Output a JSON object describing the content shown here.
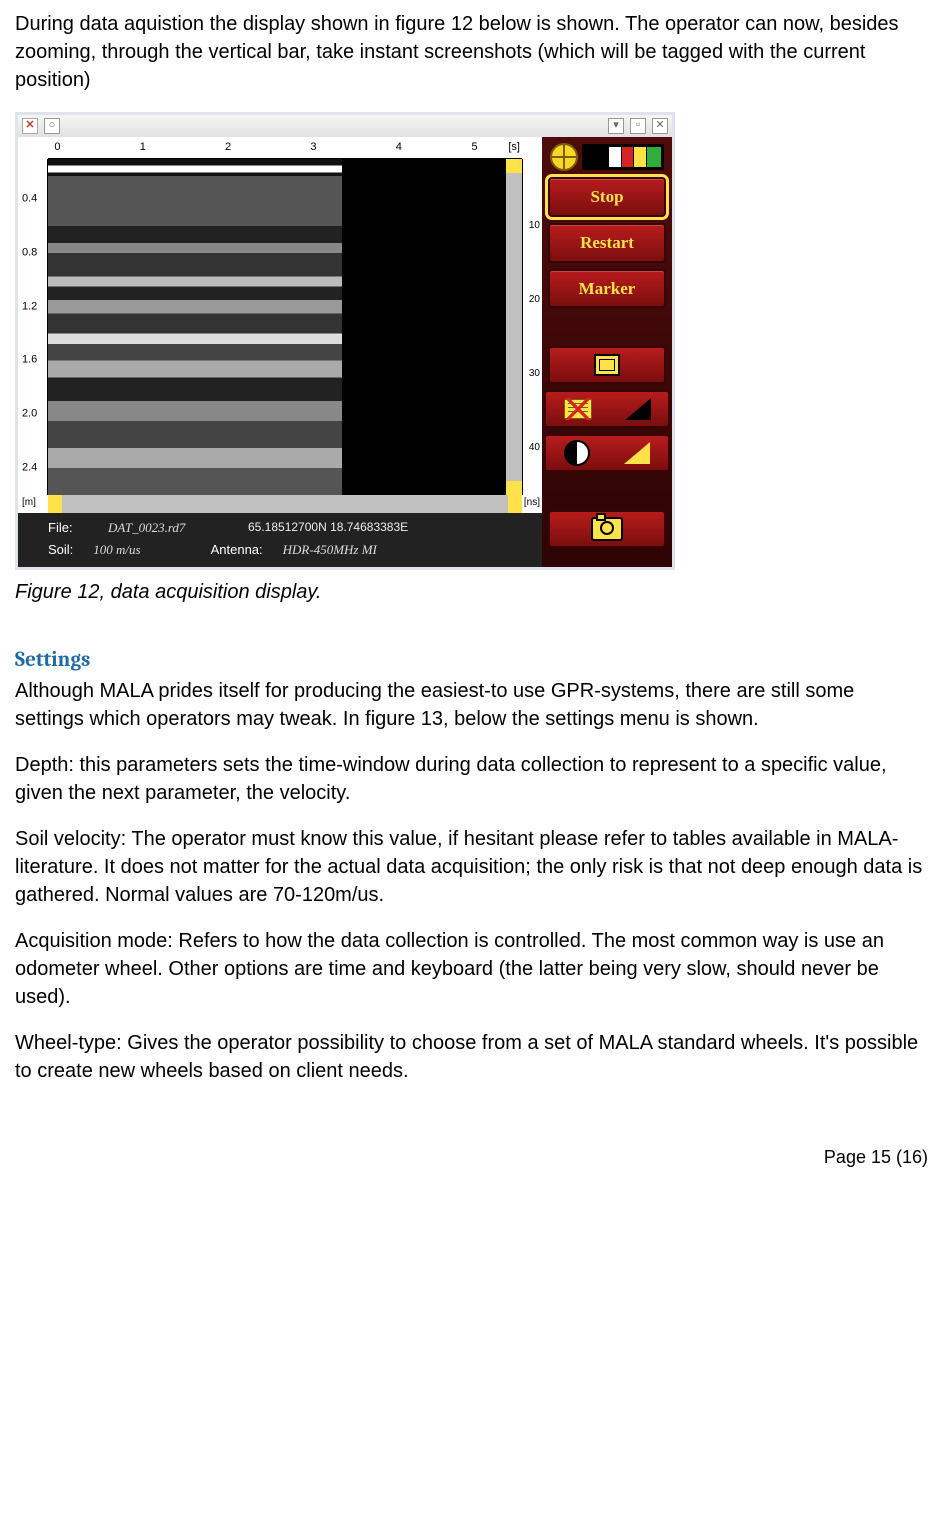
{
  "intro": "During data aquistion the display shown in figure 12 below is shown. The operator can now, besides zooming, through the vertical bar, take instant screenshots (which will be tagged with the current position)",
  "caption": "Figure 12, data acquisition display.",
  "heading_settings": "Settings",
  "settings_intro": "Although MALA prides itself for producing the easiest-to use GPR-systems, there are still some settings which operators may tweak. In figure 13, below the settings menu is shown.",
  "depth_para": "Depth: this parameters sets the time-window during data collection to represent to a specific value, given the next parameter, the velocity.",
  "soil_para": "Soil velocity: The operator must know this value, if hesitant please refer to tables available in MALA-literature. It does not matter for the actual data acquisition; the only risk is that not deep enough data is gathered. Normal values are 70-120m/us.",
  "acq_para": "Acquisition mode: Refers to how the data collection is controlled. The most common way is use an odometer wheel. Other options are time and keyboard (the latter being very slow, should never be used).",
  "wheel_para": "Wheel-type: Gives the operator possibility to choose from a set of MALA standard wheels. It's possible to create new wheels based on client needs.",
  "footer": "Page 15 (16)",
  "app": {
    "top_ticks": [
      "0",
      "1",
      "2",
      "3",
      "4",
      "5"
    ],
    "top_unit": "[s]",
    "left_ticks": [
      "0.4",
      "0.8",
      "1.2",
      "1.6",
      "2.0",
      "2.4"
    ],
    "left_unit": "[m]",
    "right_ticks": [
      "10",
      "20",
      "30",
      "40"
    ],
    "right_unit": "[ns]",
    "status": {
      "file_label": "File:",
      "file_value": "DAT_0023.rd7",
      "gps": "65.18512700N   18.74683383E",
      "soil_label": "Soil:",
      "soil_value": "100 m/us",
      "antenna_label": "Antenna:",
      "antenna_value": "HDR-450MHz MI"
    },
    "panel": {
      "stop": "Stop",
      "restart": "Restart",
      "marker": "Marker"
    }
  }
}
